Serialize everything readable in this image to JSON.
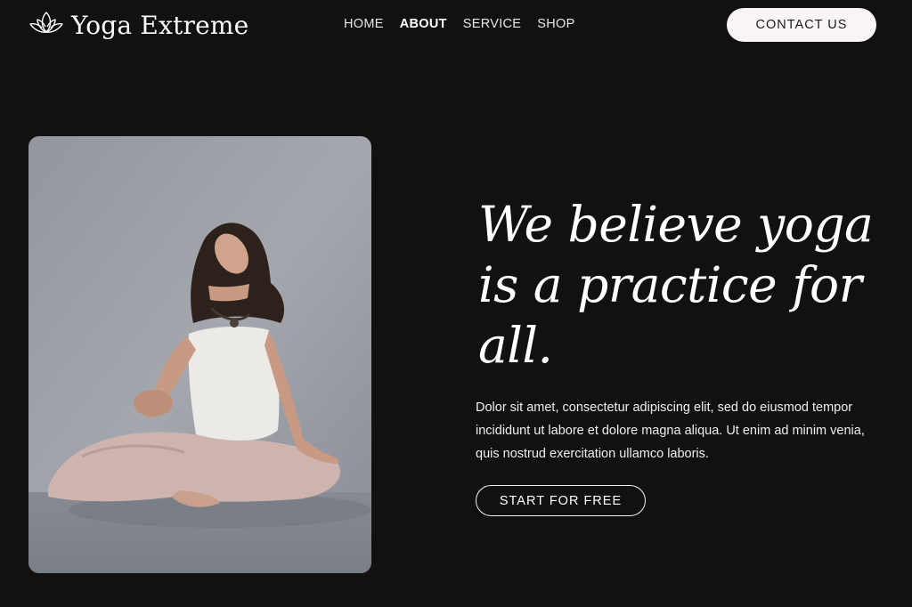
{
  "brand": {
    "name": "Yoga Extreme",
    "logo_icon": "lotus-icon"
  },
  "nav": {
    "items": [
      {
        "label": "HOME",
        "active": false
      },
      {
        "label": "ABOUT",
        "active": true
      },
      {
        "label": "SERVICE",
        "active": false
      },
      {
        "label": "SHOP",
        "active": false
      }
    ]
  },
  "header": {
    "contact_label": "CONTACT US"
  },
  "hero": {
    "headline_lines": [
      "We believe yoga",
      "is a practice for",
      "all."
    ],
    "body_lines": [
      "Dolor sit amet, consectetur adipiscing elit, sed do eiusmod tempor",
      "incididunt ut labore et dolore magna aliqua. Ut enim ad minim venia,",
      "quis nostrud exercitation ullamco laboris."
    ],
    "cta_label": "START FOR FREE"
  },
  "colors": {
    "background": "#121112",
    "button_light": "#faf5f4",
    "text": "#f4f1f1"
  }
}
